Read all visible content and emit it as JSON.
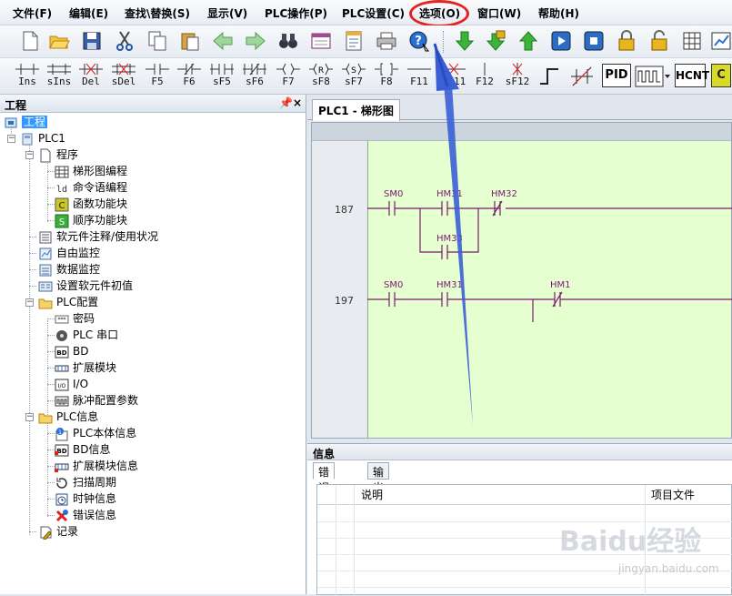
{
  "menu": {
    "items": [
      "文件(F)",
      "编辑(E)",
      "查找\\替换(S)",
      "显示(V)",
      "PLC操作(P)",
      "PLC设置(C)",
      "选项(O)",
      "窗口(W)",
      "帮助(H)"
    ],
    "highlighted": "选项(O)"
  },
  "toolbar": {
    "icons": [
      "new-file-icon",
      "open-folder-icon",
      "save-icon",
      "cut-icon",
      "copy-icon",
      "paste-icon",
      "back-arrow-icon",
      "forward-arrow-icon",
      "binoculars-icon",
      "window-icon",
      "document-icon",
      "print-icon",
      "help-icon",
      "download-arrow-icon",
      "lock-arrow-icon",
      "upload-arrow-icon",
      "run-icon",
      "stop-icon",
      "lock-icon",
      "unlock-icon",
      "monitor-icon",
      "chart-icon"
    ]
  },
  "ladder_toolbar": {
    "buttons": [
      {
        "label": "Ins",
        "icon": "insert-row-icon"
      },
      {
        "label": "sIns",
        "icon": "insert-multi-row-icon"
      },
      {
        "label": "Del",
        "icon": "delete-row-icon"
      },
      {
        "label": "sDel",
        "icon": "delete-multi-row-icon"
      },
      {
        "label": "F5",
        "icon": "no-contact-icon"
      },
      {
        "label": "F6",
        "icon": "nc-contact-icon"
      },
      {
        "label": "sF5",
        "icon": "parallel-no-contact-icon"
      },
      {
        "label": "sF6",
        "icon": "parallel-nc-contact-icon"
      },
      {
        "label": "F7",
        "icon": "coil-icon"
      },
      {
        "label": "sF8",
        "icon": "reset-coil-icon"
      },
      {
        "label": "sF7",
        "icon": "set-coil-icon"
      },
      {
        "label": "F8",
        "icon": "application-instruction-icon"
      },
      {
        "label": "F11",
        "icon": "horizontal-line-icon"
      },
      {
        "label": "sF11",
        "icon": "delete-horizontal-line-icon"
      },
      {
        "label": "F12",
        "icon": "vertical-line-icon"
      },
      {
        "label": "sF12",
        "icon": "delete-vertical-line-icon"
      }
    ],
    "extra": [
      "PID",
      "HCNT",
      "C"
    ]
  },
  "project_panel": {
    "title": "工程",
    "pin": "ᵖ",
    "close": "×",
    "tree": [
      {
        "label": "工程",
        "level": 0,
        "icon": "project-icon",
        "selected": true
      },
      {
        "label": "PLC1",
        "level": 1,
        "icon": "plc-icon"
      },
      {
        "label": "程序",
        "level": 2,
        "icon": "program-icon"
      },
      {
        "label": "梯形图编程",
        "level": 3,
        "icon": "ladder-icon"
      },
      {
        "label": "命令语编程",
        "level": 3,
        "icon": "instruction-list-icon"
      },
      {
        "label": "函数功能块",
        "level": 3,
        "icon": "function-block-icon"
      },
      {
        "label": "顺序功能块",
        "level": 3,
        "icon": "sequence-block-icon"
      },
      {
        "label": "软元件注释/使用状况",
        "level": 2,
        "icon": "comment-icon"
      },
      {
        "label": "自由监控",
        "level": 2,
        "icon": "free-monitor-icon"
      },
      {
        "label": "数据监控",
        "level": 2,
        "icon": "data-monitor-icon"
      },
      {
        "label": "设置软元件初值",
        "level": 2,
        "icon": "initial-value-icon"
      },
      {
        "label": "PLC配置",
        "level": 2,
        "icon": "folder-icon"
      },
      {
        "label": "密码",
        "level": 3,
        "icon": "password-icon"
      },
      {
        "label": "PLC 串口",
        "level": 3,
        "icon": "serial-port-icon"
      },
      {
        "label": "BD",
        "level": 3,
        "icon": "bd-icon"
      },
      {
        "label": "扩展模块",
        "level": 3,
        "icon": "expansion-module-icon"
      },
      {
        "label": "I/O",
        "level": 3,
        "icon": "io-icon"
      },
      {
        "label": "脉冲配置参数",
        "level": 3,
        "icon": "pulse-config-icon"
      },
      {
        "label": "PLC信息",
        "level": 2,
        "icon": "folder-icon"
      },
      {
        "label": "PLC本体信息",
        "level": 3,
        "icon": "info-icon"
      },
      {
        "label": "BD信息",
        "level": 3,
        "icon": "bd-info-icon"
      },
      {
        "label": "扩展模块信息",
        "level": 3,
        "icon": "expansion-info-icon"
      },
      {
        "label": "扫描周期",
        "level": 3,
        "icon": "scan-cycle-icon"
      },
      {
        "label": "时钟信息",
        "level": 3,
        "icon": "clock-icon"
      },
      {
        "label": "错误信息",
        "level": 3,
        "icon": "error-icon"
      },
      {
        "label": "记录",
        "level": 2,
        "icon": "record-icon"
      }
    ]
  },
  "document": {
    "tab": "PLC1 - 梯形图",
    "rungs": [
      {
        "step": "187",
        "contacts": [
          "SM0",
          "HM31",
          "HM32",
          "HM33"
        ]
      },
      {
        "step": "197",
        "contacts": [
          "SM0",
          "HM31",
          "HM1"
        ]
      }
    ]
  },
  "info_panel": {
    "title": "信息",
    "tabs": [
      "错误列表",
      "输出"
    ],
    "columns": [
      "说明",
      "项目文件"
    ]
  },
  "watermark": {
    "main": "Baidu经验",
    "sub": "jingyan.baidu.com"
  },
  "colors": {
    "accent": "#3399ff",
    "ladder_background": "#e6ffd0",
    "ladder_line": "#7a1a6e",
    "highlight": "#e52420",
    "arrow": "#3b5fd6"
  }
}
